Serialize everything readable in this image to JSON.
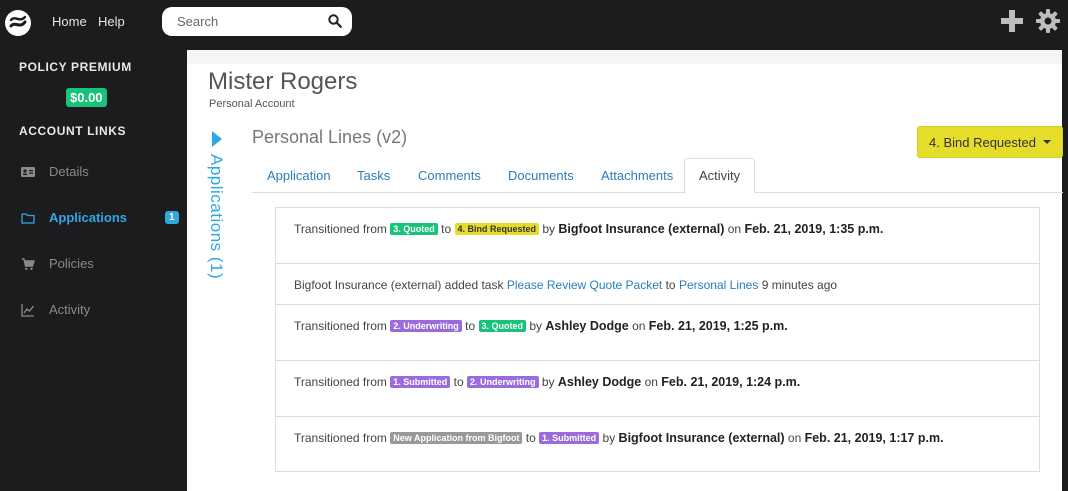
{
  "topbar": {
    "nav": [
      "Home",
      "Help"
    ],
    "search_placeholder": "Search"
  },
  "sidebar": {
    "policy_heading": "POLICY PREMIUM",
    "premium_value": "$0.00",
    "links_heading": "ACCOUNT LINKS",
    "items": [
      {
        "label": "Details",
        "icon": "id-card-icon",
        "active": false
      },
      {
        "label": "Applications",
        "icon": "folder-icon",
        "active": true,
        "count": "1"
      },
      {
        "label": "Policies",
        "icon": "cart-icon",
        "active": false
      },
      {
        "label": "Activity",
        "icon": "chart-icon",
        "active": false
      }
    ]
  },
  "account": {
    "name": "Mister Rogers",
    "type": "Personal Account",
    "vertical_label": "Applications (1)"
  },
  "application": {
    "title": "Personal Lines (v2)",
    "status_button": "4. Bind Requested",
    "tabs": [
      "Application",
      "Tasks",
      "Comments",
      "Documents",
      "Attachments",
      "Activity"
    ],
    "active_tab": "Activity"
  },
  "activity": [
    {
      "prefix": "Transitioned from",
      "from": "3. Quoted",
      "mid": "to",
      "to": "4. Bind Requested",
      "by": "by",
      "actor": "Bigfoot Insurance (external)",
      "on": "on",
      "date": "Feb. 21, 2019, 1:35 p.m."
    },
    {
      "actor": "Bigfoot Insurance (external)",
      "action": "added task",
      "task": "Please Review Quote Packet",
      "to_word": "to",
      "target": "Personal Lines",
      "ago": "9 minutes ago"
    },
    {
      "prefix": "Transitioned from",
      "from": "2. Underwriting",
      "mid": "to",
      "to": "3. Quoted",
      "by": "by",
      "actor": "Ashley Dodge",
      "on": "on",
      "date": "Feb. 21, 2019, 1:25 p.m."
    },
    {
      "prefix": "Transitioned from",
      "from": "1. Submitted",
      "mid": "to",
      "to": "2. Underwriting",
      "by": "by",
      "actor": "Ashley Dodge",
      "on": "on",
      "date": "Feb. 21, 2019, 1:24 p.m."
    },
    {
      "prefix": "Transitioned from",
      "from": "New Application from Bigfoot",
      "mid": "to",
      "to": "1. Submitted",
      "by": "by",
      "actor": "Bigfoot Insurance (external)",
      "on": "on",
      "date": "Feb. 21, 2019, 1:17 p.m."
    }
  ],
  "colors": {
    "accent": "#2ea8e0",
    "quoted": "#17c37b",
    "bind_requested": "#e5dd2a",
    "stage_purple": "#9a6bdb",
    "stage_gray": "#999999"
  }
}
